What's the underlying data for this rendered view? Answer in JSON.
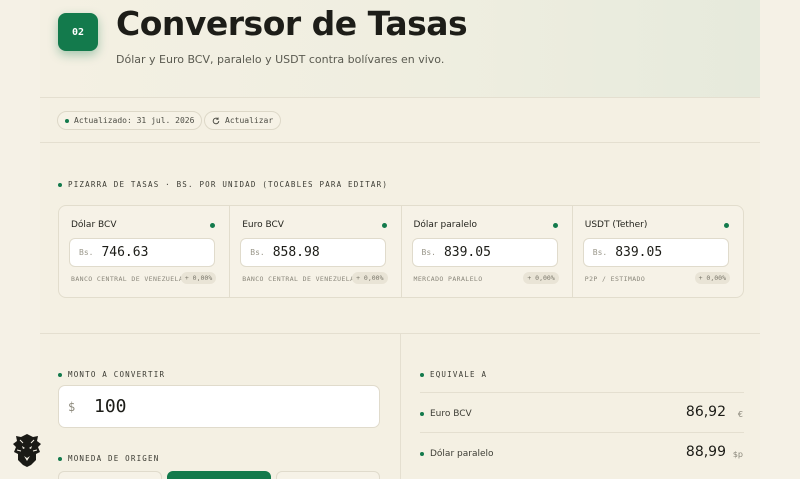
{
  "header": {
    "step": "02",
    "title": "Conversor de Tasas",
    "subtitle": "Dólar y Euro BCV, paralelo y USDT contra bolívares en vivo."
  },
  "toolbar": {
    "updated_label": "Actualizado: 31 jul. 2026",
    "refresh_label": "Actualizar",
    "refresh_icon": "refresh-icon"
  },
  "rates": {
    "section_label": "PIZARRA DE TASAS · BS. POR UNIDAD (TOCABLES PARA EDITAR)",
    "currency_prefix": "Bs.",
    "items": [
      {
        "name": "Dólar BCV",
        "value": "746.63",
        "source": "BANCO CENTRAL DE VENEZUELA",
        "change": "+ 0,00%"
      },
      {
        "name": "Euro BCV",
        "value": "858.98",
        "source": "BANCO CENTRAL DE VENEZUELA",
        "change": "+ 0,00%"
      },
      {
        "name": "Dólar paralelo",
        "value": "839.05",
        "source": "MERCADO PARALELO",
        "change": "+ 0,00%"
      },
      {
        "name": "USDT (Tether)",
        "value": "839.05",
        "source": "P2P / ESTIMADO",
        "change": "+ 0,00%"
      }
    ],
    "status_color": "#137a4c"
  },
  "converter": {
    "amount_label": "MONTO A CONVERTIR",
    "amount_prefix": "$",
    "amount_value": "100",
    "origin_label": "MONEDA DE ORIGEN"
  },
  "equivalents": {
    "label": "EQUIVALE A",
    "items": [
      {
        "name": "Euro BCV",
        "value": "86,92",
        "symbol": "€"
      },
      {
        "name": "Dólar paralelo",
        "value": "88,99",
        "symbol": "$p"
      }
    ]
  },
  "colors": {
    "accent": "#137a4c",
    "background": "#f5f1e6"
  },
  "logo_icon": "lion-head-icon"
}
